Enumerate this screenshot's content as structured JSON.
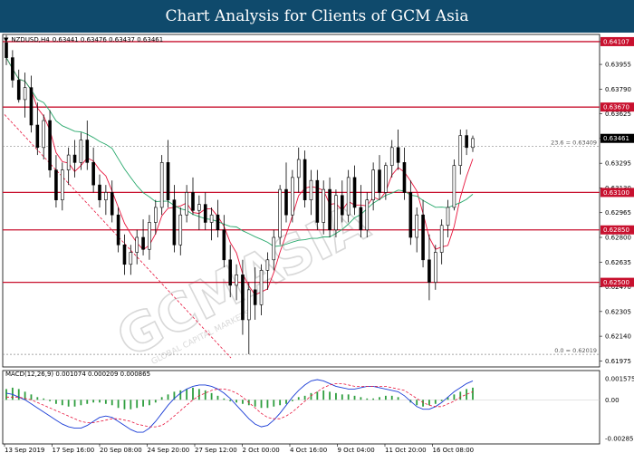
{
  "banner": {
    "title": "Chart Analysis for Clients of GCM Asia"
  },
  "instrument": {
    "symbol_tf": "NZDUSD,H4",
    "ohlc": "0.63441 0.63476 0.63437 0.63461",
    "current_price": "0.63461"
  },
  "watermark": {
    "brand": "GCMASIA",
    "sub": "GLOBAL CAPITAL MARKETS"
  },
  "chart_data": {
    "type": "candlestick",
    "y_axis_labels": [
      "0.64107",
      "0.63955",
      "0.63790",
      "0.63625",
      "0.63461",
      "0.63295",
      "0.63130",
      "0.62965",
      "0.62800",
      "0.62635",
      "0.62470",
      "0.62305",
      "0.62140",
      "0.61975"
    ],
    "x_axis_labels": [
      "13 Sep 2019",
      "17 Sep 16:00",
      "20 Sep 08:00",
      "24 Sep 20:00",
      "27 Sep 12:00",
      "2 Oct 00:00",
      "4 Oct 16:00",
      "9 Oct 04:00",
      "11 Oct 20:00",
      "16 Oct 08:00"
    ],
    "ylim": [
      0.61935,
      0.64155
    ],
    "support_resistance": [
      {
        "value": 0.64107,
        "label": "0.64107"
      },
      {
        "value": 0.6367,
        "label": "0.63670"
      },
      {
        "value": 0.631,
        "label": "0.63100"
      },
      {
        "value": 0.6285,
        "label": "0.62850"
      },
      {
        "value": 0.625,
        "label": "0.62500"
      }
    ],
    "fibonacci": [
      {
        "value": 0.63409,
        "label": "23.6 = 0.63409"
      },
      {
        "value": 0.62019,
        "label": "0.0 = 0.62019"
      }
    ],
    "candles": [
      [
        0.641,
        0.6415,
        0.6395,
        0.64
      ],
      [
        0.64,
        0.6405,
        0.638,
        0.6385
      ],
      [
        0.6385,
        0.6392,
        0.637,
        0.6372
      ],
      [
        0.6372,
        0.639,
        0.636,
        0.638
      ],
      [
        0.638,
        0.6388,
        0.635,
        0.6355
      ],
      [
        0.6355,
        0.637,
        0.6335,
        0.634
      ],
      [
        0.634,
        0.6362,
        0.6332,
        0.6358
      ],
      [
        0.6358,
        0.6365,
        0.632,
        0.6325
      ],
      [
        0.6325,
        0.6335,
        0.63,
        0.6305
      ],
      [
        0.6305,
        0.633,
        0.6298,
        0.6325
      ],
      [
        0.6325,
        0.634,
        0.6315,
        0.6335
      ],
      [
        0.6335,
        0.6345,
        0.632,
        0.633
      ],
      [
        0.633,
        0.635,
        0.6325,
        0.6345
      ],
      [
        0.6345,
        0.6358,
        0.6325,
        0.633
      ],
      [
        0.633,
        0.634,
        0.631,
        0.6315
      ],
      [
        0.6315,
        0.6322,
        0.63,
        0.6305
      ],
      [
        0.6305,
        0.6315,
        0.6295,
        0.631
      ],
      [
        0.631,
        0.6318,
        0.629,
        0.6295
      ],
      [
        0.6295,
        0.63,
        0.627,
        0.6275
      ],
      [
        0.6275,
        0.6282,
        0.6255,
        0.6262
      ],
      [
        0.6262,
        0.6275,
        0.6255,
        0.627
      ],
      [
        0.627,
        0.6285,
        0.6262,
        0.628
      ],
      [
        0.628,
        0.6292,
        0.6268,
        0.6272
      ],
      [
        0.6272,
        0.6295,
        0.6265,
        0.629
      ],
      [
        0.629,
        0.6305,
        0.6282,
        0.63
      ],
      [
        0.63,
        0.6335,
        0.6295,
        0.633
      ],
      [
        0.633,
        0.6345,
        0.63,
        0.6305
      ],
      [
        0.6305,
        0.6315,
        0.627,
        0.6275
      ],
      [
        0.6275,
        0.63,
        0.6268,
        0.6295
      ],
      [
        0.6295,
        0.6315,
        0.629,
        0.631
      ],
      [
        0.631,
        0.632,
        0.6295,
        0.6298
      ],
      [
        0.6298,
        0.6308,
        0.6285,
        0.6302
      ],
      [
        0.6302,
        0.631,
        0.6285,
        0.629
      ],
      [
        0.629,
        0.63,
        0.6278,
        0.6295
      ],
      [
        0.6295,
        0.6305,
        0.628,
        0.6285
      ],
      [
        0.6285,
        0.6295,
        0.626,
        0.6265
      ],
      [
        0.6265,
        0.6275,
        0.624,
        0.6248
      ],
      [
        0.6248,
        0.6262,
        0.6238,
        0.6255
      ],
      [
        0.6255,
        0.6265,
        0.6215,
        0.6225
      ],
      [
        0.6225,
        0.625,
        0.6202,
        0.6245
      ],
      [
        0.6245,
        0.626,
        0.6225,
        0.6235
      ],
      [
        0.6235,
        0.6262,
        0.6228,
        0.6258
      ],
      [
        0.6258,
        0.627,
        0.6245,
        0.6265
      ],
      [
        0.6265,
        0.6285,
        0.6258,
        0.628
      ],
      [
        0.628,
        0.6315,
        0.6275,
        0.6312
      ],
      [
        0.6312,
        0.633,
        0.629,
        0.6295
      ],
      [
        0.6295,
        0.6325,
        0.629,
        0.632
      ],
      [
        0.632,
        0.634,
        0.631,
        0.6332
      ],
      [
        0.6332,
        0.6338,
        0.63,
        0.6305
      ],
      [
        0.6305,
        0.6325,
        0.6295,
        0.6318
      ],
      [
        0.6318,
        0.6325,
        0.6285,
        0.629
      ],
      [
        0.629,
        0.6318,
        0.6282,
        0.6312
      ],
      [
        0.6312,
        0.632,
        0.628,
        0.6285
      ],
      [
        0.6285,
        0.6312,
        0.628,
        0.6308
      ],
      [
        0.6308,
        0.6318,
        0.629,
        0.6295
      ],
      [
        0.6295,
        0.6325,
        0.629,
        0.632
      ],
      [
        0.632,
        0.6328,
        0.6295,
        0.63
      ],
      [
        0.63,
        0.6315,
        0.628,
        0.6285
      ],
      [
        0.6285,
        0.631,
        0.628,
        0.6305
      ],
      [
        0.6305,
        0.633,
        0.6298,
        0.6325
      ],
      [
        0.6325,
        0.6335,
        0.6305,
        0.631
      ],
      [
        0.631,
        0.633,
        0.6305,
        0.6328
      ],
      [
        0.6328,
        0.6345,
        0.632,
        0.634
      ],
      [
        0.634,
        0.6352,
        0.6325,
        0.633
      ],
      [
        0.633,
        0.634,
        0.6305,
        0.631
      ],
      [
        0.631,
        0.6318,
        0.6275,
        0.628
      ],
      [
        0.628,
        0.63,
        0.627,
        0.6295
      ],
      [
        0.6295,
        0.6305,
        0.626,
        0.6265
      ],
      [
        0.6265,
        0.6282,
        0.6238,
        0.625
      ],
      [
        0.625,
        0.6275,
        0.6245,
        0.627
      ],
      [
        0.627,
        0.6292,
        0.6262,
        0.6288
      ],
      [
        0.6288,
        0.6305,
        0.628,
        0.63
      ],
      [
        0.63,
        0.6332,
        0.6298,
        0.6328
      ],
      [
        0.6328,
        0.6352,
        0.6322,
        0.6348
      ],
      [
        0.6348,
        0.6352,
        0.6335,
        0.634
      ],
      [
        0.634,
        0.6348,
        0.6337,
        0.6346
      ]
    ],
    "indicator": {
      "label": "MACD(12,26,9) 0.001074 0.000209 0.000865",
      "y_axis_labels": [
        "0.001575",
        "0.00",
        "-0.002853"
      ],
      "ylim": [
        -0.003,
        0.0019
      ],
      "histogram": [
        0.0008,
        0.0009,
        0.0008,
        0.0006,
        0.0004,
        0.0002,
        0.0001,
        -0.0001,
        -0.0003,
        -0.0004,
        -0.0005,
        -0.0005,
        -0.0004,
        -0.0003,
        -0.0002,
        -0.0002,
        -0.0003,
        -0.0004,
        -0.0006,
        -0.0007,
        -0.0007,
        -0.0006,
        -0.0005,
        -0.0004,
        -0.0002,
        0.0002,
        0.0004,
        0.0006,
        0.0007,
        0.0008,
        0.0009,
        0.0008,
        0.0007,
        0.0005,
        0.0003,
        0.0001,
        -0.0001,
        -0.0002,
        -0.0003,
        -0.0004,
        -0.0005,
        -0.0006,
        -0.0006,
        -0.0005,
        -0.0004,
        -0.0003,
        -0.0001,
        0.0002,
        0.0003,
        0.0005,
        0.0006,
        0.0007,
        0.0006,
        0.0005,
        0.0004,
        0.0004,
        0.0003,
        0.0002,
        0.0001,
        0.0001,
        0.0002,
        0.0003,
        0.0003,
        0.0002,
        0.0,
        -0.0002,
        -0.0004,
        -0.0005,
        -0.0004,
        -0.0003,
        -0.0001,
        0.0002,
        0.0004,
        0.0006,
        0.0008,
        0.0009
      ],
      "macd_line": [
        0.0005,
        0.0004,
        0.0002,
        0.0,
        -0.0003,
        -0.0006,
        -0.0009,
        -0.0012,
        -0.0015,
        -0.0018,
        -0.002,
        -0.0021,
        -0.0021,
        -0.0019,
        -0.0016,
        -0.0013,
        -0.0012,
        -0.0013,
        -0.0016,
        -0.0019,
        -0.0022,
        -0.0024,
        -0.0024,
        -0.0021,
        -0.0016,
        -0.001,
        -0.0004,
        0.0001,
        0.0005,
        0.0008,
        0.001,
        0.0011,
        0.0011,
        0.001,
        0.0008,
        0.0005,
        0.0001,
        -0.0004,
        -0.0009,
        -0.0014,
        -0.0018,
        -0.002,
        -0.0019,
        -0.0015,
        -0.001,
        -0.0004,
        0.0002,
        0.0007,
        0.0011,
        0.0014,
        0.0015,
        0.0014,
        0.0012,
        0.001,
        0.0009,
        0.0008,
        0.0008,
        0.0009,
        0.001,
        0.001,
        0.0009,
        0.0008,
        0.0007,
        0.0006,
        0.0003,
        -0.0001,
        -0.0005,
        -0.0007,
        -0.0007,
        -0.0005,
        -0.0002,
        0.0002,
        0.0006,
        0.0009,
        0.0012,
        0.0014
      ],
      "signal_line": [
        0.0002,
        0.0002,
        0.0002,
        0.0001,
        0.0,
        -0.0002,
        -0.0004,
        -0.0006,
        -0.0008,
        -0.001,
        -0.0012,
        -0.0014,
        -0.0016,
        -0.0017,
        -0.0017,
        -0.0016,
        -0.0015,
        -0.0014,
        -0.0014,
        -0.0015,
        -0.0016,
        -0.0018,
        -0.0019,
        -0.002,
        -0.002,
        -0.0019,
        -0.0016,
        -0.0012,
        -0.0008,
        -0.0004,
        0.0,
        0.0003,
        0.0005,
        0.0007,
        0.0008,
        0.0008,
        0.0007,
        0.0005,
        0.0002,
        -0.0002,
        -0.0006,
        -0.001,
        -0.0013,
        -0.0014,
        -0.0014,
        -0.0012,
        -0.0009,
        -0.0005,
        -0.0001,
        0.0003,
        0.0006,
        0.0009,
        0.0011,
        0.0012,
        0.0012,
        0.0011,
        0.001,
        0.001,
        0.001,
        0.001,
        0.001,
        0.001,
        0.0009,
        0.0008,
        0.0007,
        0.0004,
        0.0001,
        -0.0002,
        -0.0004,
        -0.0005,
        -0.0005,
        -0.0003,
        -0.0001,
        0.0002,
        0.0004,
        0.0006
      ]
    }
  },
  "colors": {
    "banner_bg": "#0f4a6c",
    "bull_body": "#ffffff",
    "bear_body": "#000000",
    "sr_line": "#c8102e",
    "ma_fast": "#e8143c",
    "ma_slow": "#27a86b",
    "macd_hist": "#2e9e3e",
    "macd_line": "#1a3cd6",
    "signal_line": "#e8143c",
    "trend_line": "#e8143c",
    "price_box": "#000000"
  }
}
